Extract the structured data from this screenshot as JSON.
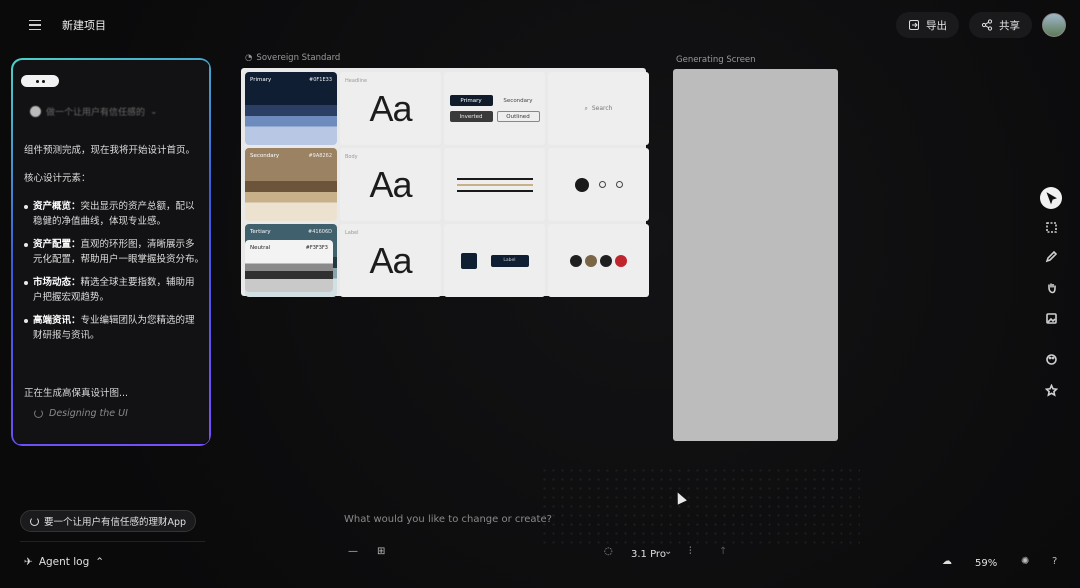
{
  "topbar": {
    "project_title": "新建项目",
    "export_label": "导出",
    "share_label": "共享"
  },
  "chat": {
    "prompt_preview": "做一个让用户有信任感的",
    "intro": "组件预测完成，现在我将开始设计首页。",
    "core_heading": "核心设计元素：",
    "items": [
      {
        "title": "资产概览：",
        "text": "突出显示的资产总额，配以稳健的净值曲线，体现专业感。"
      },
      {
        "title": "资产配置：",
        "text": "直观的环形图，清晰展示多元化配置，帮助用户一眼掌握投资分布。"
      },
      {
        "title": "市场动态：",
        "text": "精选全球主要指数，辅助用户把握宏观趋势。"
      },
      {
        "title": "高端资讯：",
        "text": "专业编辑团队为您精选的理财研报与资讯。"
      }
    ],
    "generating": "正在生成高保真设计图...",
    "status": "Designing the UI"
  },
  "task_chip": "要一个让用户有信任感的理财App",
  "agent_log": "Agent log",
  "canvas": {
    "design_system_label": "Sovereign Standard",
    "generating_label": "Generating Screen",
    "swatches": [
      {
        "name": "Primary",
        "hex": "#0F1E33"
      },
      {
        "name": "Secondary",
        "hex": "#9A8262"
      },
      {
        "name": "Tertiary",
        "hex": "#41606D"
      },
      {
        "name": "Neutral",
        "hex": "#F3F3F3"
      }
    ],
    "type_labels": [
      "Headline",
      "Body",
      "Label"
    ],
    "type_sample": "Aa",
    "buttons": [
      "Primary",
      "Secondary",
      "Inverted",
      "Outlined"
    ],
    "search_label": "Search",
    "mini_button_label": "Label"
  },
  "input": {
    "placeholder": "What would you like to change or create?",
    "model": "3.1 Pro"
  },
  "zoom": "59%",
  "colors": {
    "accent_teal": "#4fd1c5",
    "accent_purple": "#7c4dff",
    "background": "#0c0c0d"
  }
}
